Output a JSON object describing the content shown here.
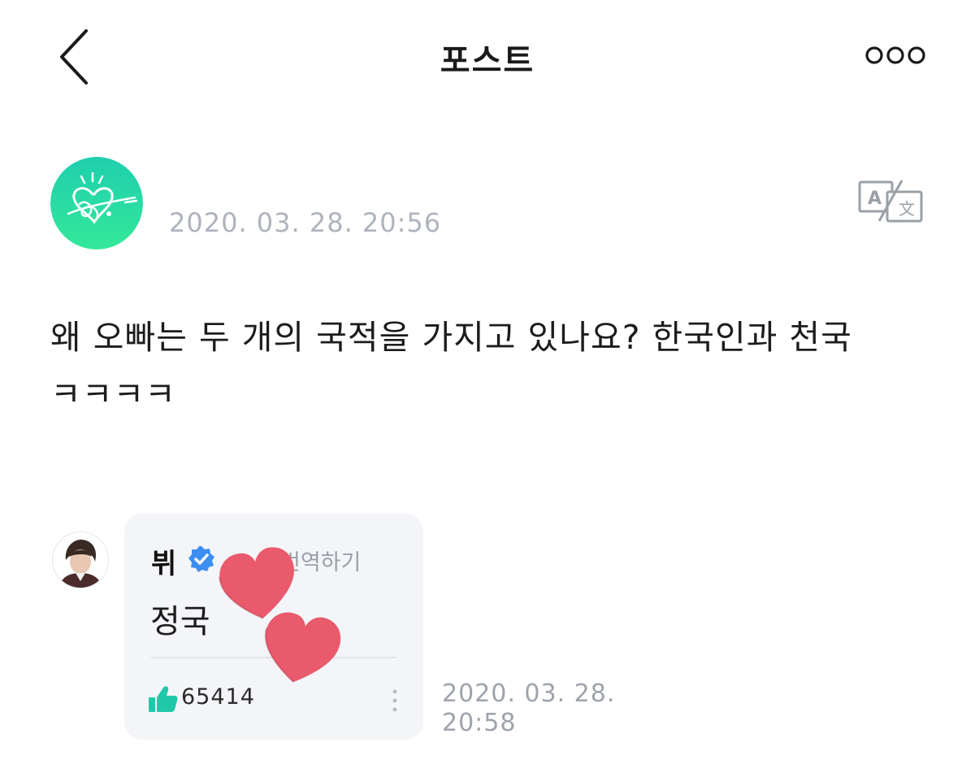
{
  "header": {
    "title": "포스트",
    "back_icon": "chevron-left-icon",
    "more_icon": "more-horizontal-circles-icon"
  },
  "post": {
    "author_avatar_icon": "heart-signature-logo",
    "timestamp": "2020. 03. 28. 20:56",
    "translate_icon": "translate-icon",
    "body": "왜 오빠는 두 개의 국적을 가지고 있나요? 한국인과 천국 ㅋㅋㅋㅋ"
  },
  "comment": {
    "author_name": "뷔",
    "verified_icon": "verified-badge-icon",
    "translate_label": "번역하기",
    "text": "정국",
    "like_icon": "thumbs-up-icon",
    "like_count": "65414",
    "menu_icon": "vertical-dots-icon",
    "timestamp_date": "2020. 03. 28.",
    "timestamp_time": "20:58"
  },
  "colors": {
    "timestamp_gray": "#aeb3bd",
    "card_background": "#f4f5f8",
    "verified_blue": "#3d8ef0",
    "like_green": "#22c7a9",
    "avatar_gradient_top": "#1fcfae",
    "avatar_gradient_bottom": "#33e899",
    "heart_pink": "#e85a6c"
  }
}
